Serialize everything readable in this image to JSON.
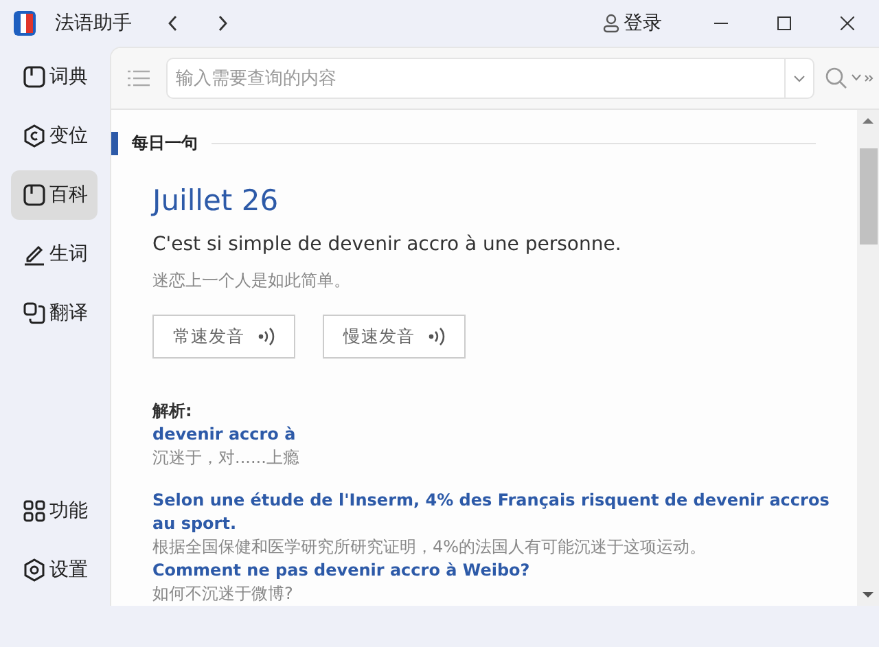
{
  "window": {
    "title": "法语助手",
    "login": "登录"
  },
  "sidebar": {
    "items": [
      {
        "label": "词典",
        "selected": false
      },
      {
        "label": "变位",
        "selected": false
      },
      {
        "label": "百科",
        "selected": true
      },
      {
        "label": "生词",
        "selected": false
      },
      {
        "label": "翻译",
        "selected": false
      }
    ],
    "bottom_items": [
      {
        "label": "功能",
        "selected": false
      },
      {
        "label": "设置",
        "selected": false
      }
    ]
  },
  "search": {
    "placeholder": "输入需要查询的内容"
  },
  "daily": {
    "section_title": "每日一句",
    "date": "Juillet 26",
    "sentence": "C'est si simple de devenir accro à une personne.",
    "translation": "迷恋上一个人是如此简单。",
    "buttons": [
      "常速发音",
      "慢速发音"
    ],
    "analysis_label": "解析:",
    "analysis": [
      {
        "kind": "term",
        "text": "devenir accro à"
      },
      {
        "kind": "gloss",
        "text": "沉迷于，对......上瘾"
      },
      {
        "kind": "gap"
      },
      {
        "kind": "term",
        "text": "Selon une étude de l'Inserm, 4% des Français risquent de devenir accros au sport."
      },
      {
        "kind": "gloss",
        "text": "根据全国保健和医学研究所研究证明，4%的法国人有可能沉迷于这项运动。"
      },
      {
        "kind": "term",
        "text": "Comment ne pas devenir accro à Weibo?"
      },
      {
        "kind": "gloss",
        "text": "如何不沉迷于微博?"
      }
    ]
  }
}
